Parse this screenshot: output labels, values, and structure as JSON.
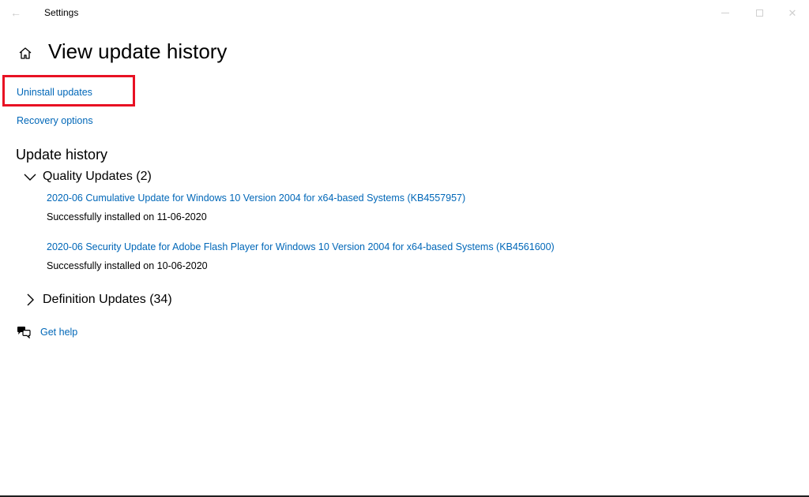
{
  "window": {
    "title": "Settings"
  },
  "page": {
    "title": "View update history"
  },
  "links": {
    "uninstall": "Uninstall updates",
    "recovery": "Recovery options"
  },
  "history": {
    "heading": "Update history",
    "quality": {
      "label": "Quality Updates (2)",
      "expanded": true,
      "items": [
        {
          "title": "2020-06 Cumulative Update for Windows 10 Version 2004 for x64-based Systems (KB4557957)",
          "status": "Successfully installed on 11-06-2020"
        },
        {
          "title": "2020-06 Security Update for Adobe Flash Player for Windows 10 Version 2004 for x64-based Systems (KB4561600)",
          "status": "Successfully installed on 10-06-2020"
        }
      ]
    },
    "definition": {
      "label": "Definition Updates (34)",
      "expanded": false
    }
  },
  "help": {
    "label": "Get help"
  },
  "colors": {
    "accent_link": "#0067b8",
    "highlight_border": "#e81123",
    "background": "#ffffff"
  },
  "icons": {
    "back": "back-arrow-icon",
    "home": "home-icon",
    "expand": "chevron-down-icon",
    "collapse": "chevron-right-icon",
    "help": "chat-bubbles-icon",
    "minimize": "minimize-icon",
    "maximize": "maximize-icon",
    "close": "close-icon"
  }
}
